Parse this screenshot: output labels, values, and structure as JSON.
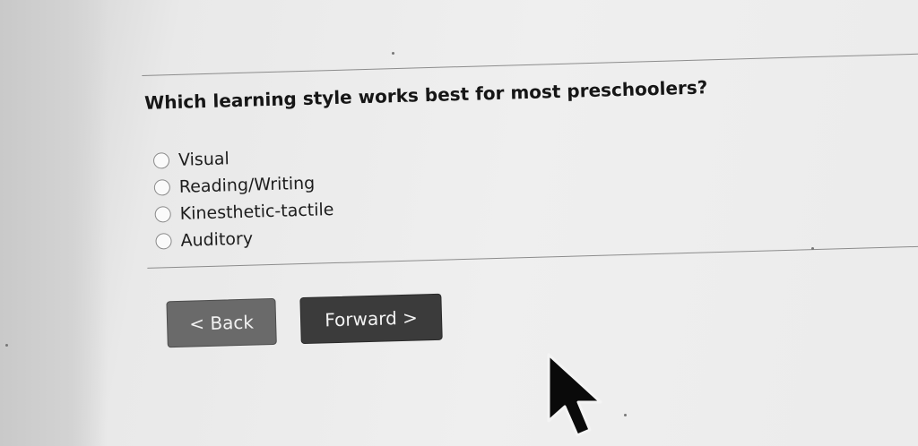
{
  "quiz": {
    "question": "Which learning style works best for most preschoolers?",
    "options": [
      {
        "label": "Visual",
        "selected": false
      },
      {
        "label": "Reading/Writing",
        "selected": false
      },
      {
        "label": "Kinesthetic-tactile",
        "selected": false
      },
      {
        "label": "Auditory",
        "selected": false
      }
    ]
  },
  "navigation": {
    "back_label": "< Back",
    "forward_label": "Forward >"
  },
  "colors": {
    "back_button": "#6a6a6a",
    "forward_button": "#3b3b3b",
    "text": "#161616"
  },
  "icons": {
    "cursor": "mouse-pointer-icon"
  }
}
